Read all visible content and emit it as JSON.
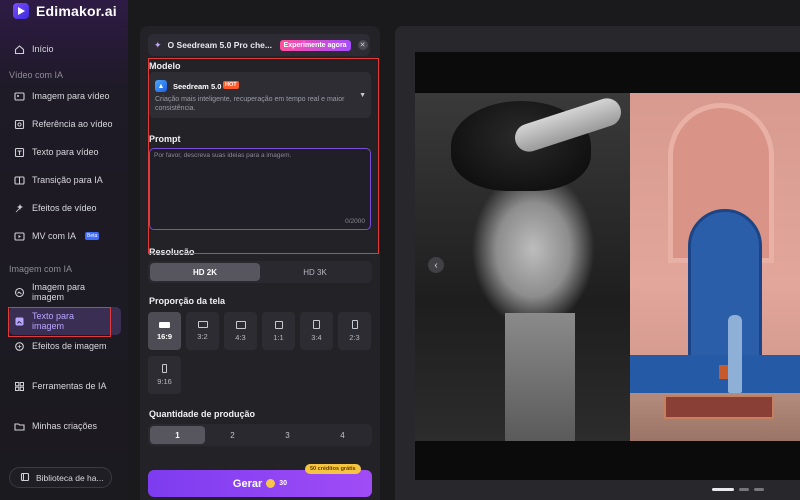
{
  "app": {
    "title": "Edimakor.ai"
  },
  "sidebar": {
    "home": "Início",
    "section_video": "Vídeo com IA",
    "video_items": [
      {
        "label": "Imagem para vídeo"
      },
      {
        "label": "Referência ao vídeo"
      },
      {
        "label": "Texto para vídeo"
      },
      {
        "label": "Transição para IA"
      },
      {
        "label": "Efeitos de vídeo"
      },
      {
        "label": "MV com IA",
        "badge": "Beta"
      }
    ],
    "section_image": "Imagem com IA",
    "image_items": [
      {
        "label": "Imagem para imagem"
      },
      {
        "label": "Texto para imagem",
        "active": true
      },
      {
        "label": "Efeitos de imagem"
      }
    ],
    "tools": "Ferramentas de IA",
    "creations": "Minhas criações",
    "library": "Biblioteca de ha..."
  },
  "panel": {
    "banner": {
      "text": "O Seedream 5.0 Pro che...",
      "try_label": "Experimente agora"
    },
    "model_label": "Modelo",
    "model": {
      "name": "Seedream 5.0",
      "badge": "HOT",
      "description": "Criação mais inteligente, recuperação em tempo real e maior consistência."
    },
    "prompt_label": "Prompt",
    "prompt": {
      "placeholder": "Por favor, descreva suas ideias para a imagem.",
      "value": "",
      "counter": "0/2000"
    },
    "resolution_label": "Resolução",
    "resolution_options": [
      "HD 2K",
      "HD 3K"
    ],
    "resolution_selected": "HD 2K",
    "aspect_label": "Proporção da tela",
    "aspect_options": [
      "16:9",
      "3:2",
      "4:3",
      "1:1",
      "3:4",
      "2:3",
      "9:16"
    ],
    "aspect_selected": "16:9",
    "quantity_label": "Quantidade de produção",
    "quantity_options": [
      "1",
      "2",
      "3",
      "4"
    ],
    "quantity_selected": "1",
    "generate": {
      "label": "Gerar",
      "cost": "30",
      "badge": "50 créditos grátis"
    }
  },
  "colors": {
    "accent": "#8b45f3",
    "highlight_box": "#e03a3a",
    "background": "#1a1a1d"
  }
}
